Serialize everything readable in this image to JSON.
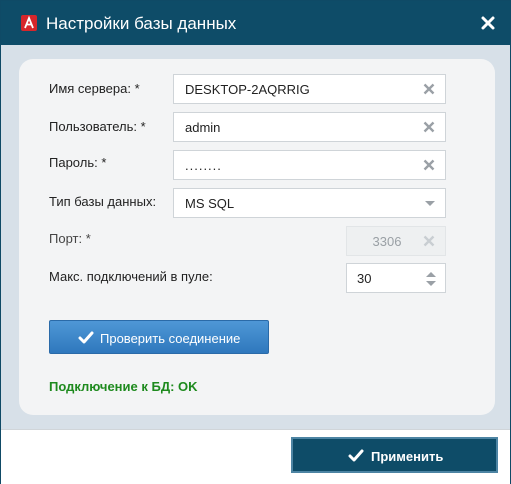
{
  "window": {
    "title": "Настройки базы данных"
  },
  "fields": {
    "server": {
      "label": "Имя сервера: *",
      "value": "DESKTOP-2AQRRIG"
    },
    "user": {
      "label": "Пользователь: *",
      "value": "admin"
    },
    "password": {
      "label": "Пароль: *",
      "value": "........"
    },
    "db_type": {
      "label": "Тип базы данных:",
      "value": "MS SQL"
    },
    "port": {
      "label": "Порт: *",
      "value": "3306"
    },
    "pool": {
      "label": "Макс. подключений в пуле:",
      "value": "30"
    }
  },
  "buttons": {
    "test_connection": "Проверить соединение",
    "apply": "Применить"
  },
  "status": {
    "text": "Подключение к БД: OK",
    "color": "#1e8a1e"
  },
  "colors": {
    "titlebar": "#0e4c68",
    "accent_button": "#3584c8",
    "app_icon": "#d7262b"
  },
  "icons": {
    "app": "app-logo-icon",
    "close": "close-icon",
    "clear": "clear-icon",
    "dropdown": "chevron-down-icon",
    "check": "checkmark-icon"
  }
}
